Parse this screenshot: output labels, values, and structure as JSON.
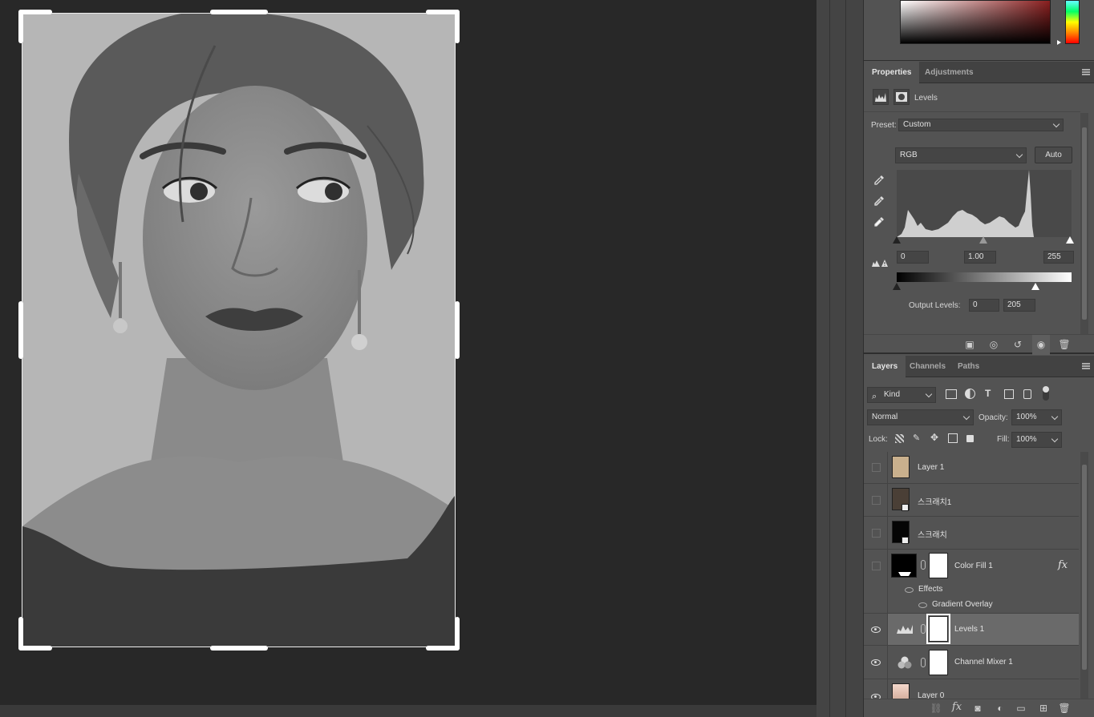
{
  "properties_panel": {
    "tabs": [
      "Properties",
      "Adjustments"
    ],
    "adjustment_name": "Levels",
    "preset_label": "Preset:",
    "preset_value": "Custom",
    "channel_value": "RGB",
    "auto_button": "Auto",
    "input_black": "0",
    "input_gamma": "1.00",
    "input_white": "255",
    "output_label": "Output Levels:",
    "output_black": "0",
    "output_white": "205"
  },
  "layers_panel": {
    "tabs": [
      "Layers",
      "Channels",
      "Paths"
    ],
    "filter_kind": "Kind",
    "blend_mode": "Normal",
    "opacity_label": "Opacity:",
    "opacity_value": "100%",
    "lock_label": "Lock:",
    "fill_label": "Fill:",
    "fill_value": "100%",
    "layers": [
      {
        "name": "Layer 1",
        "visible": false
      },
      {
        "name": "스크래치1",
        "visible": false
      },
      {
        "name": "스크래치",
        "visible": false
      },
      {
        "name": "Color Fill 1",
        "visible": false,
        "effects_label": "Effects",
        "effect": "Gradient Overlay",
        "fx": "fx"
      },
      {
        "name": "Levels 1",
        "visible": true,
        "selected": true
      },
      {
        "name": "Channel Mixer 1",
        "visible": true
      },
      {
        "name": "Layer 0",
        "visible": true
      }
    ],
    "footer_fx": "fx"
  }
}
